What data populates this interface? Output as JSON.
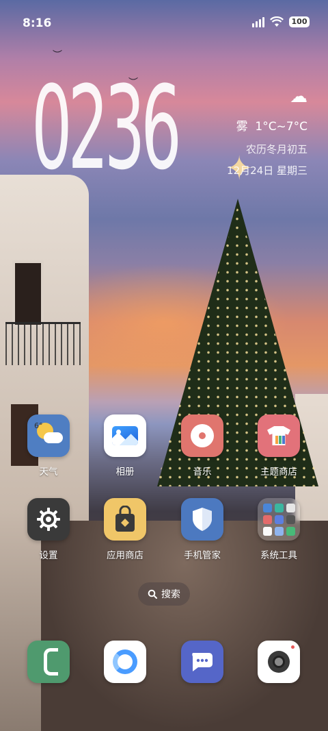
{
  "status": {
    "time": "8:16",
    "battery": "100"
  },
  "clock": {
    "digits": "0236"
  },
  "weather": {
    "condition": "雾",
    "temp_range": "1°C~7°C",
    "lunar_date": "农历冬月初五",
    "date": "12月24日 星期三"
  },
  "apps_row1": [
    {
      "label": "天气",
      "icon": "weather-icon",
      "color": "#4f7ec2"
    },
    {
      "label": "相册",
      "icon": "gallery-icon",
      "color": "#ffffff"
    },
    {
      "label": "音乐",
      "icon": "music-icon",
      "color": "#e0756e"
    },
    {
      "label": "主题商店",
      "icon": "theme-store-icon",
      "color": "#e2727a"
    }
  ],
  "apps_row2": [
    {
      "label": "设置",
      "icon": "settings-gear-icon",
      "color": "#3a3a3a"
    },
    {
      "label": "应用商店",
      "icon": "app-store-bag-icon",
      "color": "#f0c668"
    },
    {
      "label": "手机管家",
      "icon": "phone-manager-shield-icon",
      "color": "#4c79c0"
    },
    {
      "label": "系统工具",
      "icon": "system-tools-folder-icon",
      "color": "#ffffff"
    }
  ],
  "search": {
    "label": "搜索"
  },
  "dock": [
    {
      "icon": "phone-icon",
      "color": "#4f9a6e"
    },
    {
      "icon": "browser-icon",
      "color": "#ffffff"
    },
    {
      "icon": "messages-icon",
      "color": "#5566c8"
    },
    {
      "icon": "camera-icon",
      "color": "#ffffff"
    }
  ]
}
